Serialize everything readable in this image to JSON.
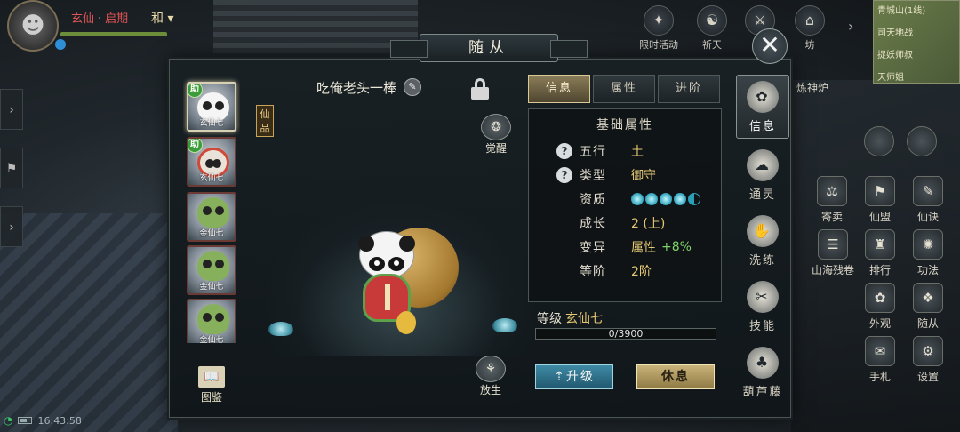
{
  "hud": {
    "realm": "玄仙",
    "realm_sub": "启期",
    "harmony": "和",
    "time": "16:43:58"
  },
  "top_bar": [
    {
      "label": "限时活动",
      "icon": "limited-event-icon"
    },
    {
      "label": "祈天",
      "icon": "pray-icon"
    },
    {
      "label": "征",
      "icon": "campaign-icon"
    },
    {
      "label": "坊",
      "icon": "market-icon"
    }
  ],
  "minimap": {
    "zone": "青城山(1线)",
    "npc1": "司天地战",
    "npc2": "捉妖师叔",
    "npc3": "天师姐"
  },
  "right_functions": [
    {
      "label": "寄卖",
      "icon": "consign-icon"
    },
    {
      "label": "仙盟",
      "icon": "alliance-icon"
    },
    {
      "label": "仙诀",
      "icon": "skill-scroll-icon"
    },
    {
      "label": "山海残卷",
      "icon": "shanhai-icon"
    },
    {
      "label": "排行",
      "icon": "ranking-icon"
    },
    {
      "label": "功法",
      "icon": "technique-icon"
    },
    {
      "label": "外观",
      "icon": "appearance-icon"
    },
    {
      "label": "随从",
      "icon": "companion-icon"
    },
    {
      "label": "手札",
      "icon": "notebook-icon"
    },
    {
      "label": "设置",
      "icon": "settings-icon"
    }
  ],
  "right_partial": "炼神炉",
  "dialog": {
    "title": "随从",
    "pet_name": "吃俺老头一棒",
    "grade_tag": "仙品",
    "handbook_label": "图鉴",
    "awaken_label": "觉醒",
    "release_label": "放生",
    "assist_badge": "助",
    "pets": [
      {
        "type": "panda",
        "label": "玄仙七",
        "assist": true,
        "selected": true
      },
      {
        "type": "lion",
        "label": "玄仙七",
        "assist": true,
        "selected": false
      },
      {
        "type": "leaf",
        "label": "金仙七",
        "assist": false,
        "selected": false
      },
      {
        "type": "leaf",
        "label": "金仙七",
        "assist": false,
        "selected": false
      },
      {
        "type": "leaf",
        "label": "金仙七",
        "assist": false,
        "selected": false
      }
    ],
    "tabs": [
      {
        "label": "信息",
        "active": true
      },
      {
        "label": "属性",
        "active": false
      },
      {
        "label": "进阶",
        "active": false
      }
    ],
    "attrs_title": "基础属性",
    "attrs": [
      {
        "key": "五行",
        "value": "土",
        "help": true
      },
      {
        "key": "类型",
        "value": "御守",
        "help": true
      },
      {
        "key": "资质",
        "value": "",
        "gems": 4.5,
        "help": false
      },
      {
        "key": "成长",
        "value": "2 (上)",
        "help": false
      },
      {
        "key": "变异",
        "value": "属性",
        "extra": "+8%",
        "help": false
      },
      {
        "key": "等阶",
        "value": "2阶",
        "help": false
      }
    ],
    "level_label": "等级",
    "level_value": "玄仙七",
    "exp_text": "0/3900",
    "exp_fraction": 0,
    "upgrade_label": "升级",
    "rest_label": "休息",
    "categories": [
      {
        "label": "信息",
        "active": true,
        "icon": "info-icon"
      },
      {
        "label": "通灵",
        "active": false,
        "icon": "spirit-icon"
      },
      {
        "label": "洗练",
        "active": false,
        "icon": "refine-icon"
      },
      {
        "label": "技能",
        "active": false,
        "icon": "skill-icon"
      },
      {
        "label": "葫芦藤",
        "active": false,
        "icon": "gourd-icon"
      }
    ]
  },
  "colors": {
    "accent_gold": "#e5c873",
    "tab_active": "#8a7d59",
    "upgrade_btn": "#3f8aa6",
    "rest_btn": "#c9b37a",
    "green_bonus": "#7fd36a"
  }
}
